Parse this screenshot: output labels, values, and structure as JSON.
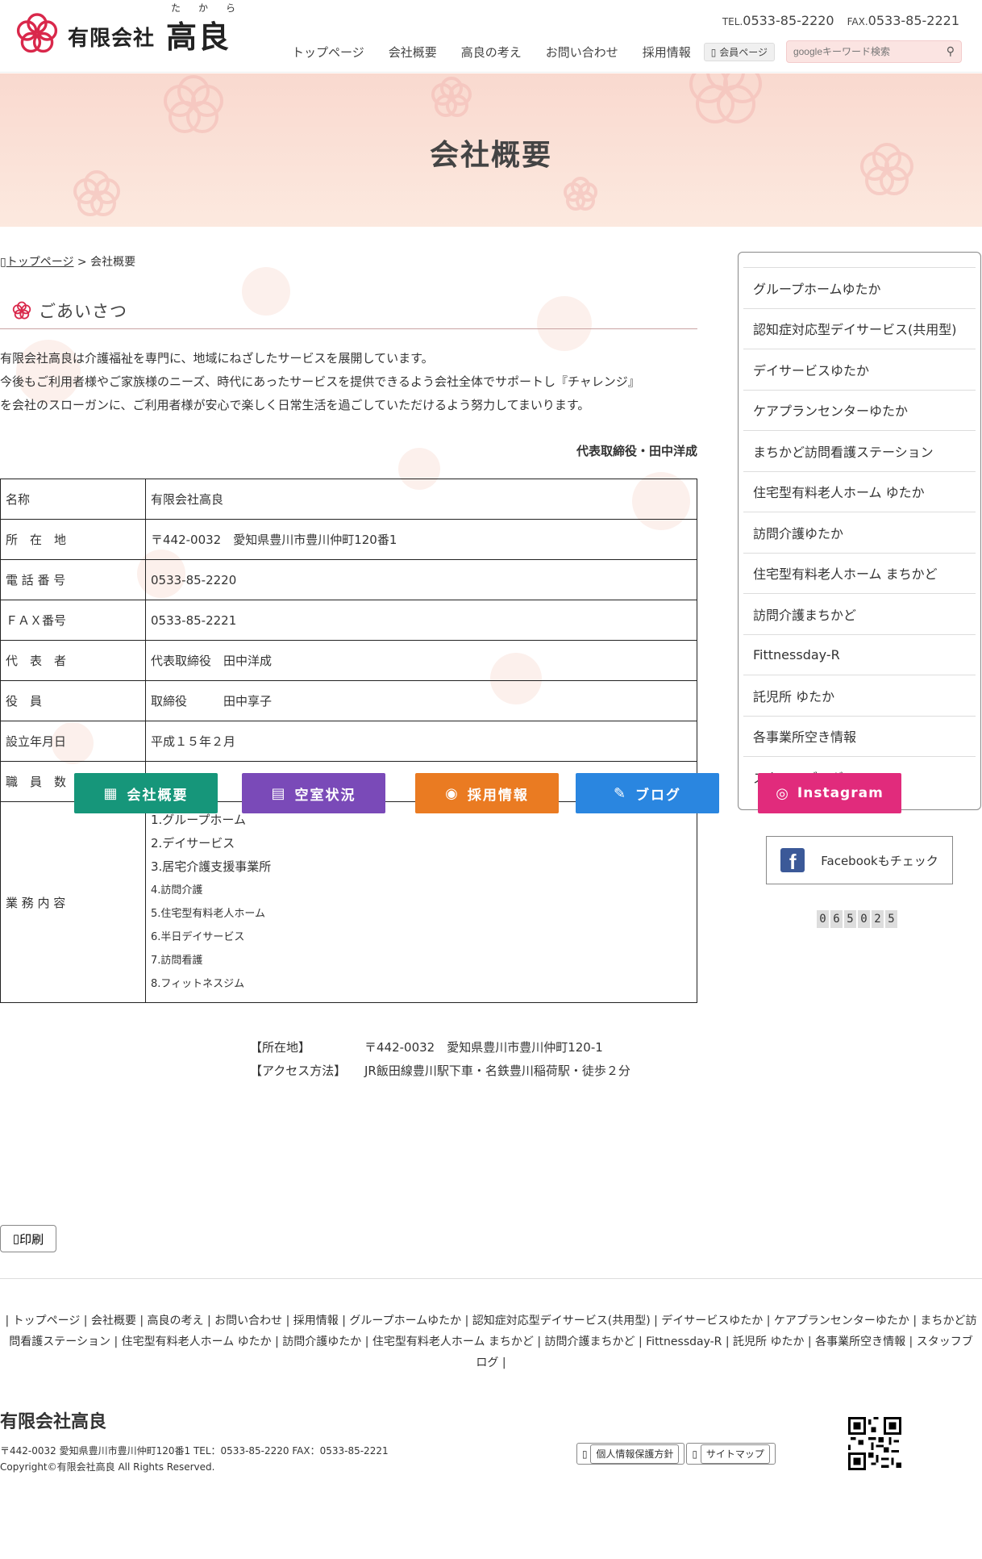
{
  "header": {
    "company": "有限会社",
    "name": "高良",
    "ruby": "たから",
    "tel_label": "TEL.",
    "tel": "0533-85-2220",
    "fax_label": "FAX.",
    "fax": "0533-85-2221",
    "nav": [
      "トップページ",
      "会社概要",
      "高良の考え",
      "お問い合わせ",
      "採用情報"
    ],
    "member_button": "会員ページ",
    "search_placeholder": "googleキーワード検索",
    "search_icon": "search-icon"
  },
  "hero": {
    "title": "会社概要"
  },
  "breadcrumb": {
    "home": "トップページ",
    "sep": ">",
    "current": "会社概要"
  },
  "greeting": {
    "heading": "ごあいさつ",
    "lines": [
      "有限会社高良は介護福祉を専門に、地域にねざしたサービスを展開しています。",
      "今後もご利用者様やご家族様のニーズ、時代にあったサービスを提供できるよう会社全体でサポートし『チャレンジ』",
      "を会社のスローガンに、ご利用者様が安心で楽しく日常生活を過ごしていただけるよう努力してまいります。"
    ],
    "signature": "代表取締役・田中洋成"
  },
  "company_table": {
    "rows": [
      {
        "label": "名称",
        "value": "有限会社高良"
      },
      {
        "label": "所　在　地",
        "value": "〒442-0032　愛知県豊川市豊川仲町120番1"
      },
      {
        "label": "電 話 番 号",
        "value": "0533-85-2220"
      },
      {
        "label": "ＦＡＸ番号",
        "value": "0533-85-2221"
      },
      {
        "label": "代　表　者",
        "value": "代表取締役　田中洋成"
      },
      {
        "label": "役　員",
        "value": "取締役　　　田中享子"
      },
      {
        "label": "設立年月日",
        "value": "平成１５年２月"
      },
      {
        "label": "職　員　数",
        "value": ""
      }
    ],
    "business_label": "業 務 内 容",
    "business": [
      "1.グループホーム",
      "2.デイサービス",
      "3.居宅介護支援事業所",
      "4.訪問介護",
      "5.住宅型有料老人ホーム",
      "6.半日デイサービス",
      "7.訪問看護",
      "8.フィットネスジム"
    ]
  },
  "float_buttons": [
    {
      "label": "会社概要",
      "color": "#16967a",
      "icon": "building-icon"
    },
    {
      "label": "空室状況",
      "color": "#7a4ab8",
      "icon": "grid-icon"
    },
    {
      "label": "採用情報",
      "color": "#ea7b22",
      "icon": "person-search-icon"
    },
    {
      "label": "ブログ",
      "color": "#2a86e0",
      "icon": "edit-icon"
    },
    {
      "label": "Instagram",
      "color": "#e12b7c",
      "icon": "instagram-icon"
    }
  ],
  "sidebar": {
    "items": [
      "グループホームゆたか",
      "認知症対応型デイサービス(共用型)",
      "デイサービスゆたか",
      "ケアプランセンターゆたか",
      "まちかど訪問看護ステーション",
      "住宅型有料老人ホーム ゆたか",
      "訪問介護ゆたか",
      "住宅型有料老人ホーム まちかど",
      "訪問介護まちかど",
      "Fittnessday-R",
      "託児所 ゆたか",
      "各事業所空き情報",
      "スタッフブログ"
    ]
  },
  "facebook": {
    "label": "Facebookもチェック"
  },
  "counter": [
    "0",
    "6",
    "5",
    "0",
    "2",
    "5"
  ],
  "address": {
    "location_label": "【所在地】",
    "location": "〒442-0032　愛知県豊川市豊川仲町120‐1",
    "access_label": "【アクセス方法】",
    "access": "JR飯田線豊川駅下車・名鉄豊川稲荷駅・徒歩２分"
  },
  "print_button": "印刷",
  "footer": {
    "links_text": "| トップページ | 会社概要 | 高良の考え | お問い合わせ | 採用情報 | グループホームゆたか | 認知症対応型デイサービス(共用型) | デイサービスゆたか | ケアプランセンターゆたか | まちかど訪問看護ステーション | 住宅型有料老人ホーム ゆたか | 訪問介護ゆたか | 住宅型有料老人ホーム まちかど | 訪問介護まちかど | Fittnessday-R | 託児所 ゆたか | 各事業所空き情報 | スタッフブログ |",
    "name": "有限会社高良",
    "address": "〒442-0032 愛知県豊川市豊川仲町120番1 TEL：0533-85-2220  FAX：0533-85-2221",
    "copyright": "Copyright©有限会社高良 All Rights Reserved.",
    "privacy": "個人情報保護方針",
    "sitemap": "サイトマップ"
  },
  "colors": {
    "brand": "#d9284b",
    "hero_bg": "#f9d9cf"
  }
}
